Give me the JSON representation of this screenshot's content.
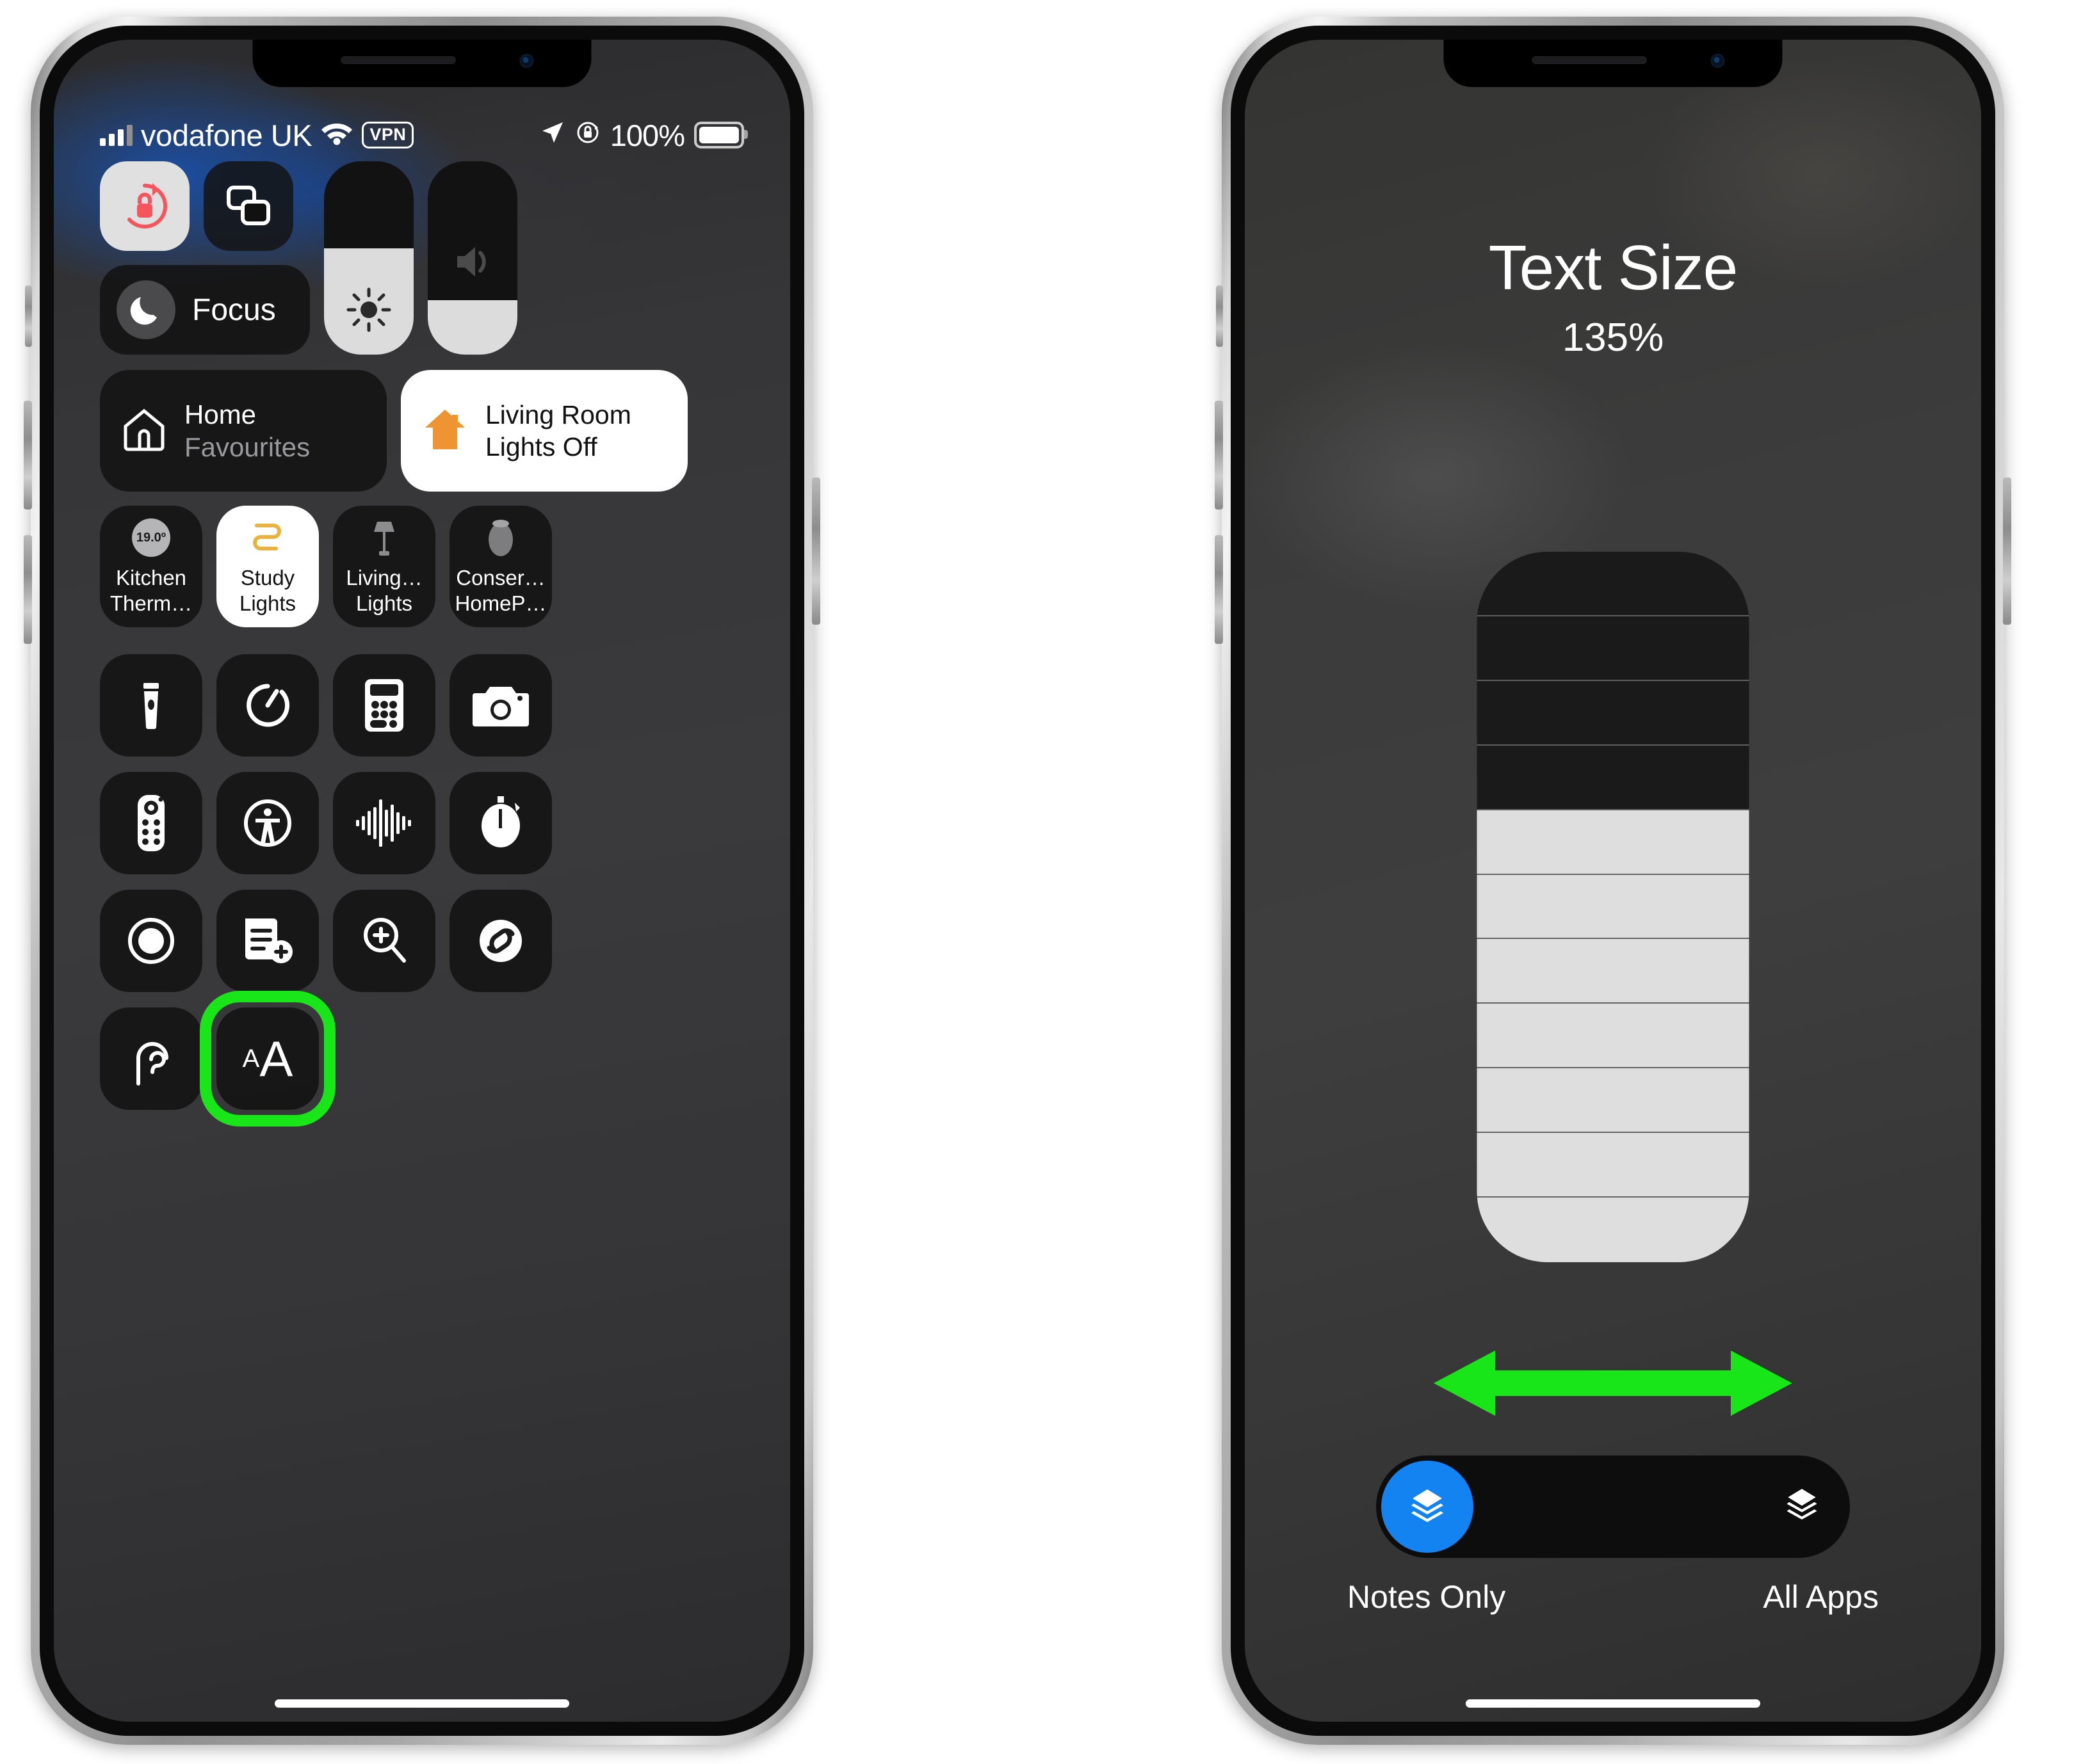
{
  "left_phone": {
    "status_bar": {
      "carrier": "vodafone UK",
      "vpn_badge": "VPN",
      "battery_percent": "100%",
      "icons": [
        "signal-bars-icon",
        "wifi-icon",
        "vpn-badge",
        "location-arrow-icon",
        "rotation-lock-icon",
        "battery-icon"
      ]
    },
    "toggles": {
      "rotation_lock": {
        "name": "rotation-lock-toggle",
        "state": "on"
      },
      "screen_mirroring": {
        "name": "screen-mirroring-toggle",
        "state": "off"
      }
    },
    "focus": {
      "label": "Focus",
      "icon": "moon-icon"
    },
    "brightness": {
      "name": "brightness-slider",
      "icon": "sun-icon",
      "level_percent": 55
    },
    "volume": {
      "name": "volume-slider",
      "icon": "speaker-icon",
      "level_percent": 28
    },
    "home_tiles": [
      {
        "title": "Home",
        "subtitle": "Favourites",
        "icon": "house-outline-icon",
        "style": "dark"
      },
      {
        "title": "Living Room",
        "subtitle": "Lights Off",
        "icon": "house-filled-icon",
        "style": "white"
      }
    ],
    "accessories": [
      {
        "label_line1": "Kitchen",
        "label_line2": "Therm…",
        "value": "19.0º",
        "icon": "thermostat-icon",
        "active": false
      },
      {
        "label_line1": "Study",
        "label_line2": "Lights",
        "icon": "light-strip-icon",
        "active": true
      },
      {
        "label_line1": "Living…",
        "label_line2": "Lights",
        "icon": "floor-lamp-icon",
        "active": false
      },
      {
        "label_line1": "Conser…",
        "label_line2": "HomeP…",
        "icon": "homepod-icon",
        "active": false
      }
    ],
    "control_grid": [
      [
        "flashlight-icon",
        "timer-icon",
        "calculator-icon",
        "camera-icon"
      ],
      [
        "apple-tv-remote-icon",
        "accessibility-icon",
        "sound-recognition-icon",
        "stopwatch-icon"
      ],
      [
        "screen-record-icon",
        "quick-note-icon",
        "magnifier-icon",
        "shazam-icon"
      ],
      [
        "hearing-icon",
        "text-size-icon"
      ]
    ],
    "highlighted_control": {
      "name": "text-size-control",
      "label": "AA",
      "highlight_color": "#19E619"
    }
  },
  "right_phone": {
    "title": "Text Size",
    "value": "135%",
    "slider": {
      "name": "text-size-slider",
      "total_segments": 11,
      "filled_segments": 7
    },
    "annotation_arrow": {
      "name": "drag-arrow-annotation",
      "color": "#19E619",
      "direction": "horizontal"
    },
    "scope_toggle": {
      "selected": "Notes Only",
      "left_label": "Notes Only",
      "right_label": "All Apps",
      "knob_color": "#1283f1",
      "left_icon": "stack-filled-icon",
      "right_icon": "stack-outline-icon"
    }
  }
}
